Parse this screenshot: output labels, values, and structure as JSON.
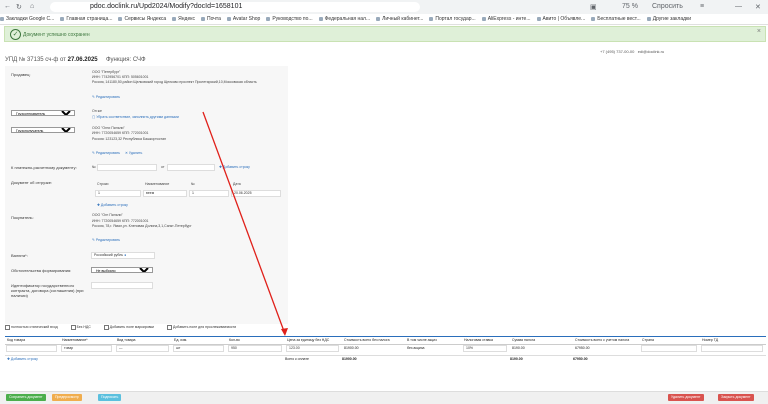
{
  "browser": {
    "url": "pdoc.doclink.ru/Upd2024/Modify?docId=1658101",
    "zoom": "75 %",
    "ask_label": "Спросить",
    "bookmarks": [
      "Закладки Google C...",
      "Главная страница...",
      "Сервисы Яндекса",
      "Яндекс",
      "Почта",
      "Avatar Shop",
      "Руководство по...",
      "Федеральная нал...",
      "Личный кабинет...",
      "Портал государ...",
      "AliExpress - инте...",
      "Авито | Объявле...",
      "Бесплатные вест...",
      "Другие закладки"
    ]
  },
  "alert": {
    "text": "Документ успешно сохранен",
    "close": "×"
  },
  "topinfo": {
    "phone": "+7 (495) 737-00-00",
    "email": "edi@doclink.ru"
  },
  "header": {
    "doc_title": "УПД № 37135 сч-ф  от",
    "date": "27.06.2025",
    "function": "Функция: СЧФ"
  },
  "seller": {
    "label": "Продавец:",
    "name": "ООО \"Петербург\"",
    "inn": "ИНН: 7742956701 КПП: 505601001",
    "address": "Россия, 141180,50,район Щелковский город Щелково проспект Пролетарский,10,Московская область",
    "edit": "Редактировать"
  },
  "shipper": {
    "select": "Грузоотправитель",
    "same": "Он же",
    "link": "Убрать соответствие, заполнить другими данными"
  },
  "consignee": {
    "select": "Грузополучатель",
    "name": "ООО \"Огни Пильни\"",
    "inn": "ИНН: 7720054659 КПП: 772001001",
    "address": "Россия: 123123,32 Республика Башкортостан",
    "edit": "Редактировать",
    "remove": "Удалить"
  },
  "payment_doc": {
    "label": "К платежно-расчетному документу:",
    "no": "№",
    "from": "от",
    "add": "Добавить строку"
  },
  "shipment_doc": {
    "label": "Документ об отгрузке:",
    "cols": [
      "Строки",
      "Наименование",
      "№",
      "Дата"
    ],
    "vals": [
      "1",
      "веем",
      "1",
      "20.06.2025"
    ],
    "add": "Добавить строку"
  },
  "buyer": {
    "label": "Покупатель:",
    "name": "ООО \"Огн Пильни\"",
    "inn": "ИНН: 7720054659 КПП: 772001001",
    "address": "Россия, 78,г. Ямал,ул. Кленовая Долина,3,1,Санкт-Петербург",
    "edit": "Редактировать"
  },
  "currency": {
    "label": "Валюта*:",
    "value": "Российский рубль"
  },
  "formation": {
    "label": "Обстоятельства формирования:",
    "value": "Не выбрано"
  },
  "contract": {
    "label": "Идентификатор государственного контракта, договора (соглашения) (при наличии)"
  },
  "options": [
    "полностью статический вход",
    "Без НДС",
    "Добавить поле маркировки",
    "Добавить поле для прослеживаемости"
  ],
  "table": {
    "headers": [
      "Код товара",
      "Наименование*",
      "Вид товара",
      "Ед. изм.",
      "Кол-во",
      "Цена за единицу без НДС",
      "Стоимость всего без налога",
      "В том числе акциз",
      "Налоговая ставка",
      "Сумма налога",
      "Стоимость всего с учетом налога",
      "Страна",
      "Номер ТД"
    ],
    "row": [
      "",
      "товар",
      "—",
      "шт",
      "950",
      "123.00",
      "81900.00",
      "без акциза",
      "10%",
      "8190.00",
      "67950.00",
      "",
      ""
    ],
    "add_row": "Добавить строку",
    "totals_label": "Всего к оплате",
    "totals": [
      "81900.00",
      "",
      "8190.00",
      "67950.00"
    ]
  },
  "footer": {
    "buttons": [
      "Сохранить документ",
      "Предпросмотр",
      "Подписать",
      "Удалить документ",
      "Закрыть документ"
    ],
    "colors": [
      "#4cae4c",
      "#f0ad4e",
      "#5bc0de",
      "#d9534f",
      "#d9534f"
    ]
  }
}
